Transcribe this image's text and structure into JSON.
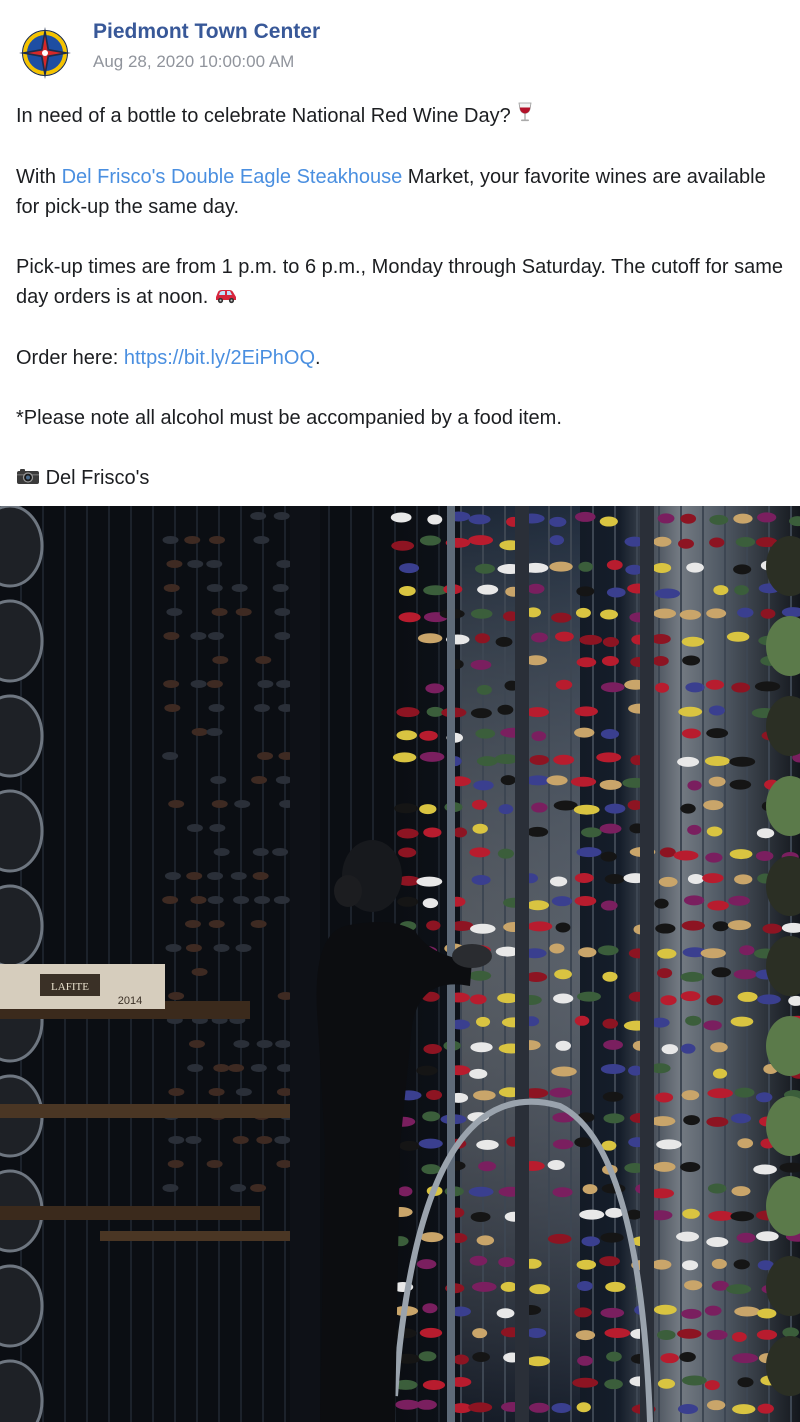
{
  "post": {
    "page_name": "Piedmont Town Center",
    "timestamp": "Aug 28, 2020 10:00:00 AM",
    "paragraphs": {
      "p1": "In need of a bottle to celebrate National Red Wine Day?",
      "p2_before": "With ",
      "p2_link": "Del Frisco's Double Eagle Steakhouse",
      "p2_after": " Market, your favorite wines are available for pick-up the same day.",
      "p3": "Pick-up times are from 1 p.m. to 6 p.m., Monday through Saturday. The cutoff for same day orders is at noon.",
      "p4_before": "Order here: ",
      "p4_link": "https://bit.ly/2EiPhOQ",
      "p4_after": ".",
      "p5": "*Please note all alcohol must be accompanied by a food item.",
      "p6": "Del Frisco's"
    },
    "icons": {
      "avatar": "compass-logo-icon",
      "wine": "wine-glass-icon",
      "car": "car-icon",
      "camera": "camera-icon"
    },
    "photo": {
      "box_text_1": "LAFITE",
      "box_text_2": "2014"
    },
    "colors": {
      "page_name": "#385898",
      "link": "#4a8fe0",
      "timestamp": "#90949c",
      "text": "#1c1e21"
    }
  }
}
